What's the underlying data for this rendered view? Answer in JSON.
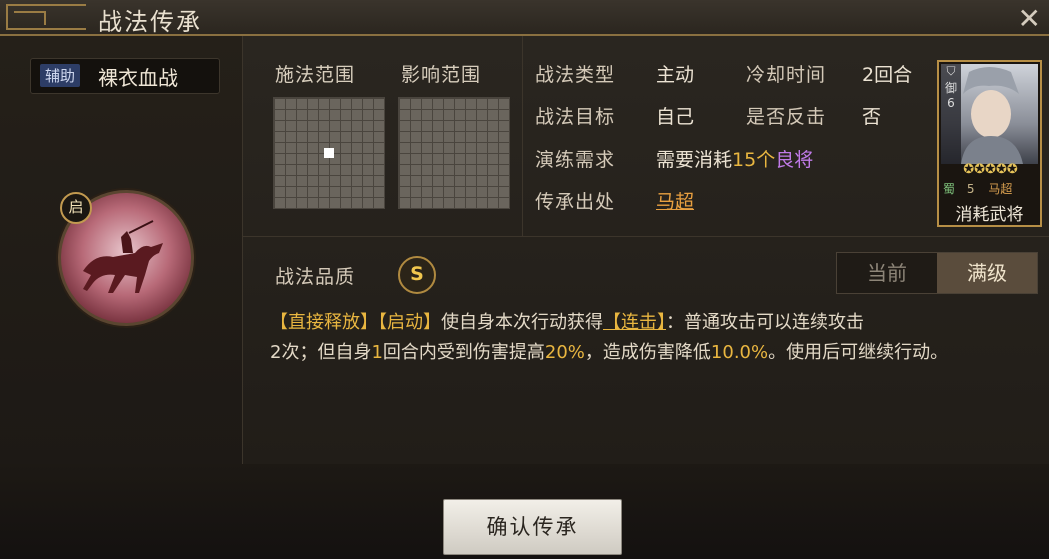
{
  "window": {
    "title": "战法传承",
    "close_glyph": "✕"
  },
  "skill": {
    "tag": "辅助",
    "name": "裸衣血战",
    "badge": "启",
    "icon_name": "horse-rider-icon"
  },
  "ranges": {
    "cast_label": "施法范围",
    "effect_label": "影响范围"
  },
  "info": {
    "type_label": "战法类型",
    "type_value": "主动",
    "cooldown_label": "冷却时间",
    "cooldown_value": "2回合",
    "target_label": "战法目标",
    "target_value": "自己",
    "counter_label": "是否反击",
    "counter_value": "否",
    "req_label": "演练需求",
    "req_prefix": "需要消耗",
    "req_count": "15个",
    "req_item": "良将",
    "source_label": "传承出处",
    "source_value": "马超"
  },
  "card": {
    "side_top": "御",
    "side_num": "6",
    "stars": "✪✪✪✪✪",
    "faction": "蜀",
    "cost": "5",
    "general": "马超",
    "caption": "消耗武将"
  },
  "quality": {
    "label": "战法品质",
    "value": "S"
  },
  "level_toggle": {
    "current": "当前",
    "max": "满级"
  },
  "description": {
    "kw1": "【直接释放】",
    "kw2": "【启动】",
    "t1": "使自身本次行动获得",
    "kw3": "【连击】",
    "t2": "：普通攻击可以连续攻击",
    "t3": "2次；但自身",
    "n1": "1",
    "t4": "回合内受到伤害提高",
    "n2": "20%",
    "t5": "，造成伤害降低",
    "n3": "10.0%",
    "t6": "。使用后可继续行动。"
  },
  "confirm_label": "确认传承"
}
